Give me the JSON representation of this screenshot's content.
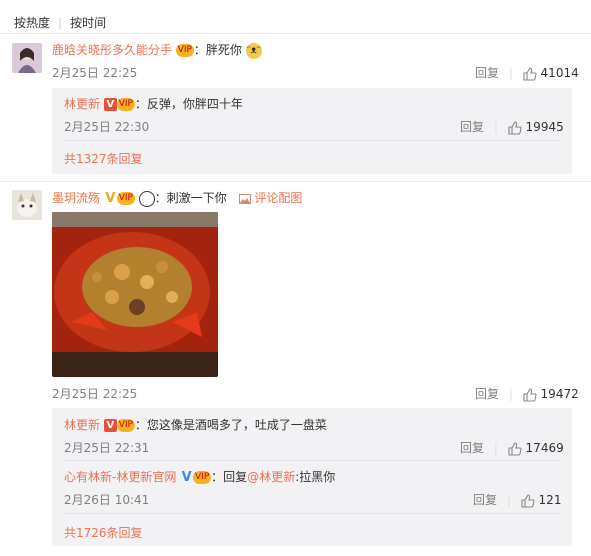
{
  "sort": {
    "hot": "按热度",
    "time": "按时间"
  },
  "c1": {
    "user": "鹿晗关晓彤多久能分手",
    "text": "：胖死你",
    "time": "2月25日 22:25",
    "reply": "回复",
    "likes": "41014",
    "replies": [
      {
        "user": "林更新",
        "text": "：反弹，你胖四十年",
        "time": "2月25日 22:30",
        "reply": "回复",
        "likes": "19945"
      }
    ],
    "more": "共1327条回复"
  },
  "c2": {
    "user": "墨玥流殇",
    "text": "：刺激一下你",
    "pic_link": "评论配图",
    "time": "2月25日 22:25",
    "reply": "回复",
    "likes": "19472",
    "replies": [
      {
        "user": "林更新",
        "text": "：您这像是酒喝多了，吐成了一盘菜",
        "time": "2月25日 22:31",
        "reply": "回复",
        "likes": "17469"
      },
      {
        "user": "心有林新-林更新官网",
        "text_prefix": "：回复",
        "mention": "@林更新",
        "text": ":拉黑你",
        "time": "2月26日 10:41",
        "reply": "回复",
        "likes": "121"
      }
    ],
    "more": "共1726条回复"
  },
  "icons": {
    "verified_red": "V",
    "verified_yellow": "V",
    "verified_blue": "V",
    "vip": "VIP",
    "emoji_laugh": "emoji-icon",
    "emoji_cat": "cat-emoji-icon",
    "panda": "panda-icon",
    "like": "thumbs-up-icon",
    "pic": "image-icon"
  },
  "colors": {
    "username": "#eb7350",
    "reply_bg": "#f2f2f5",
    "verified": "#e5523a"
  }
}
